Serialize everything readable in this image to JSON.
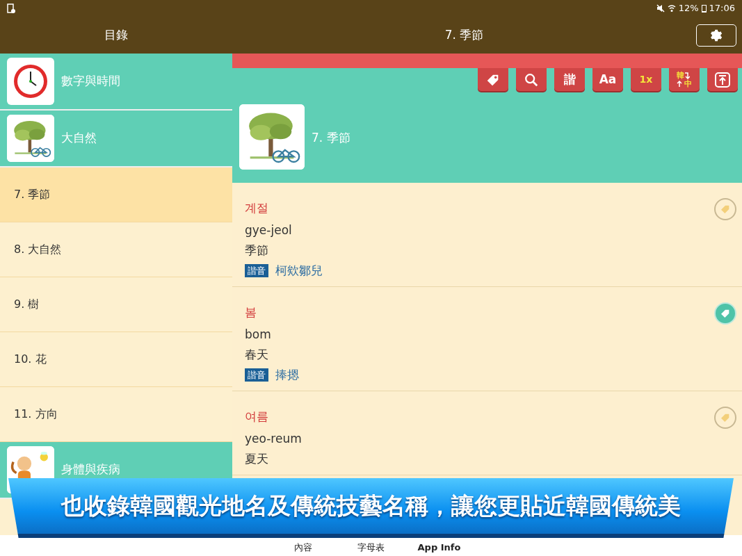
{
  "status_bar": {
    "battery": "12%",
    "time": "17:06"
  },
  "app_bar": {
    "left_title": "目錄",
    "title": "7. 季節"
  },
  "sidebar": {
    "items": [
      {
        "kind": "category",
        "label": "數字與時間",
        "selected": false
      },
      {
        "kind": "category",
        "label": "大自然",
        "selected": false
      },
      {
        "kind": "lesson",
        "label": "7. 季節",
        "selected": true
      },
      {
        "kind": "lesson",
        "label": "8. 大自然",
        "selected": false
      },
      {
        "kind": "lesson",
        "label": "9. 樹",
        "selected": false
      },
      {
        "kind": "lesson",
        "label": "10. 花",
        "selected": false
      },
      {
        "kind": "lesson",
        "label": "11. 方向",
        "selected": false
      },
      {
        "kind": "category",
        "label": "身體與疾病",
        "selected": false
      }
    ]
  },
  "toolbar": [
    {
      "kind": "tag"
    },
    {
      "kind": "search"
    },
    {
      "kind": "text",
      "label": "諧"
    },
    {
      "kind": "text",
      "label": "Aa"
    },
    {
      "kind": "speed",
      "label": "1x"
    },
    {
      "kind": "swap",
      "top": "韓",
      "bottom": "中"
    },
    {
      "kind": "top"
    }
  ],
  "lesson_header": {
    "title": "7. 季節"
  },
  "entries": [
    {
      "korean": "계절",
      "romanization": "gye-jeol",
      "meaning": "季節",
      "homophone_badge": "諧音",
      "homophone": "柯欸鄒兒",
      "bookmarked": false
    },
    {
      "korean": "봄",
      "romanization": "bom",
      "meaning": "春天",
      "homophone_badge": "諧音",
      "homophone": "捧摁",
      "bookmarked": true
    },
    {
      "korean": "여름",
      "romanization": "yeo-reum",
      "meaning": "夏天",
      "bookmarked": false
    }
  ],
  "banner": "也收錄韓國觀光地名及傳統技藝名稱，讓您更貼近韓國傳統美",
  "bottom_nav": [
    {
      "label": "內容"
    },
    {
      "label": "字母表"
    },
    {
      "label": "App Info"
    }
  ]
}
